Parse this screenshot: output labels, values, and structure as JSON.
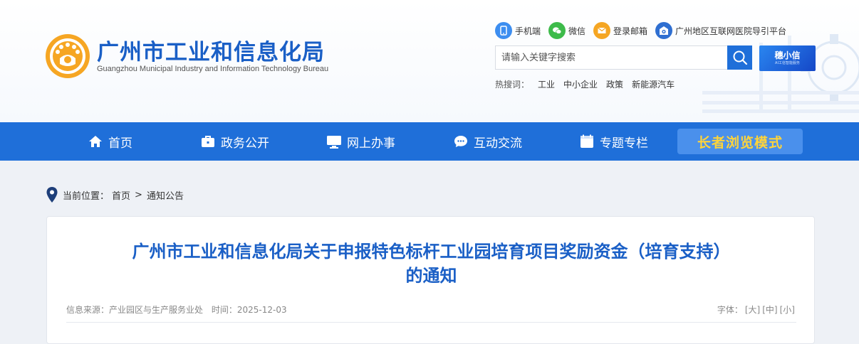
{
  "header": {
    "title": "广州市工业和信息化局",
    "subtitle": "Guangzhou Municipal Industry and Information Technology Bureau",
    "quick_links": [
      {
        "icon": "mobile-icon",
        "label": "手机端",
        "color": "#3d8ef0"
      },
      {
        "icon": "wechat-icon",
        "label": "微信",
        "color": "#3dbb4a"
      },
      {
        "icon": "mail-icon",
        "label": "登录邮箱",
        "color": "#f5a623"
      },
      {
        "icon": "hospital-guide-icon",
        "label": "广州地区互联网医院导引平台",
        "color": "#2f6fd1"
      }
    ],
    "search": {
      "placeholder": "请输入关键字搜索"
    },
    "assistant": {
      "name": "穗小信",
      "tagline": "AI工信智能服务"
    },
    "hot_label": "热搜词：",
    "hot_keywords": [
      "工业",
      "中小企业",
      "政策",
      "新能源汽车"
    ]
  },
  "nav": {
    "items": [
      {
        "icon": "home-icon",
        "label": "首页"
      },
      {
        "icon": "briefcase-icon",
        "label": "政务公开"
      },
      {
        "icon": "monitor-icon",
        "label": "网上办事"
      },
      {
        "icon": "chat-icon",
        "label": "互动交流"
      },
      {
        "icon": "calendar-icon",
        "label": "专题专栏"
      }
    ],
    "elder_mode": "长者浏览模式"
  },
  "breadcrumb": {
    "label": "当前位置：",
    "items": [
      "首页",
      "通知公告"
    ],
    "separator": ">"
  },
  "article": {
    "title_line1": "广州市工业和信息化局关于申报特色标杆工业园培育项目奖励资金（培育支持）",
    "title_line2": "的通知",
    "source": "信息来源：产业园区与生产服务业处",
    "date": "时间：2025-12-03",
    "font_label": "字体：",
    "font_sizes": [
      "[大]",
      "[中]",
      "[小]"
    ]
  },
  "colors": {
    "brand": "#1f6fd9",
    "title": "#1a5fc6",
    "elder_text": "#ffd43a"
  }
}
